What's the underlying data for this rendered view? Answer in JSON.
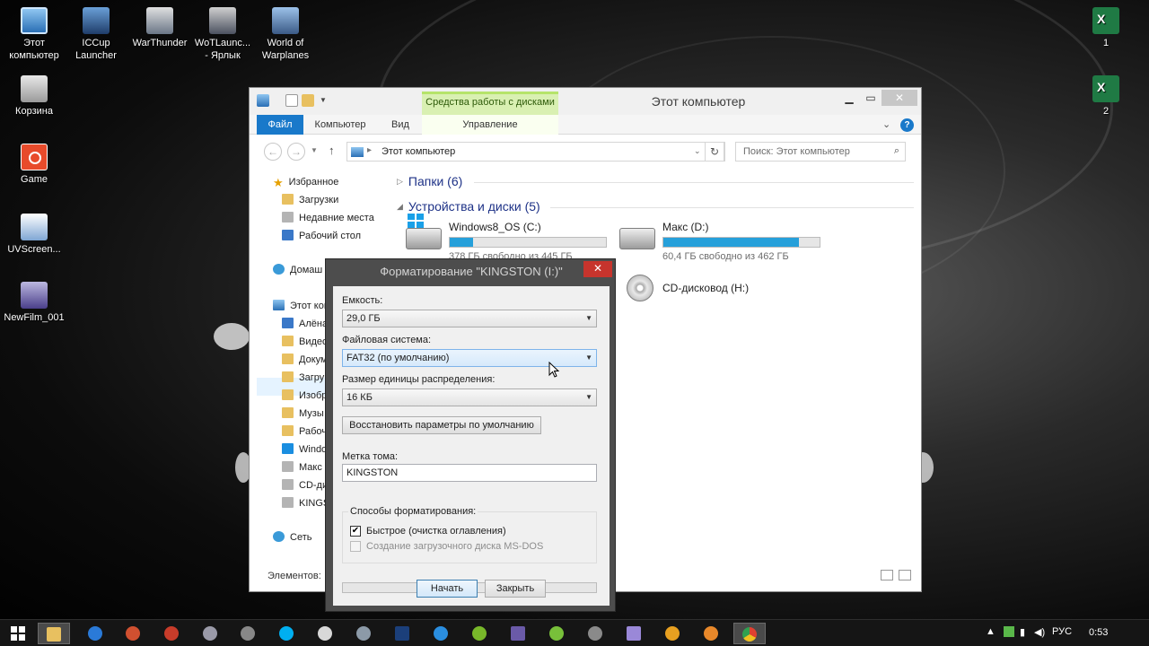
{
  "desktop": {
    "icons": [
      {
        "label1": "Этот",
        "label2": "компьютер",
        "icon": "computer-icon"
      },
      {
        "label1": "ICCup",
        "label2": "Launcher",
        "icon": "iccup-launcher-icon"
      },
      {
        "label1": "WarThunder",
        "label2": "",
        "icon": "warthunder-icon"
      },
      {
        "label1": "WoTLaunc...",
        "label2": "- Ярлык",
        "icon": "wot-launcher-icon"
      },
      {
        "label1": "World of",
        "label2": "Warplanes",
        "icon": "warplanes-icon"
      },
      {
        "label1": "Корзина",
        "label2": "",
        "icon": "recycle-bin-icon"
      },
      {
        "label1": "Game",
        "label2": "",
        "icon": "game-icon"
      },
      {
        "label1": "UVScreen...",
        "label2": "",
        "icon": "uvscreen-icon"
      },
      {
        "label1": "NewFilm_001",
        "label2": "",
        "icon": "avi-file-icon"
      },
      {
        "label1": "1",
        "label2": "",
        "icon": "excel-file-icon"
      },
      {
        "label1": "2",
        "label2": "",
        "icon": "excel-file-icon"
      }
    ]
  },
  "explorer": {
    "title": "Этот компьютер",
    "contextual_group": "Средства работы с дисками",
    "tabs": {
      "file": "Файл",
      "computer": "Компьютер",
      "view": "Вид",
      "manage": "Управление"
    },
    "address_path": "Этот компьютер",
    "search_placeholder": "Поиск: Этот компьютер",
    "nav": {
      "favorites": "Избранное",
      "downloads": "Загрузки",
      "recent": "Недавние места",
      "desktop": "Рабочий стол",
      "homegroup": "Домаш",
      "thispc": "Этот ком",
      "pc_items": [
        "Алёна",
        "Видео",
        "Докум",
        "Загру",
        "Изобр",
        "Музы",
        "Рабоч",
        "Windo",
        "Макс",
        "CD-ди",
        "KINGS"
      ],
      "network": "Сеть"
    },
    "groups": {
      "folders": "Папки (6)",
      "devices": "Устройства и диски (5)"
    },
    "drives": [
      {
        "name": "Windows8_OS (C:)",
        "free": "378 ГБ свободно из 445 ГБ",
        "used_fraction": 0.15
      },
      {
        "name": "Макс (D:)",
        "free": "60,4 ГБ свободно из 462 ГБ",
        "used_fraction": 0.87
      },
      {
        "name": "CD-дисковод (H:)"
      }
    ],
    "status": "Элементов: "
  },
  "format_dialog": {
    "title": "Форматирование \"KINGSTON (I:)\"",
    "capacity_label": "Емкость:",
    "capacity_value": "29,0 ГБ",
    "fs_label": "Файловая система:",
    "fs_value": "FAT32 (по умолчанию)",
    "alloc_label": "Размер единицы распределения:",
    "alloc_value": "16 КБ",
    "restore_button": "Восстановить параметры по умолчанию",
    "volume_label": "Метка тома:",
    "volume_value": "KINGSTON",
    "options_legend": "Способы форматирования:",
    "quick_format": "Быстрое (очистка оглавления)",
    "quick_format_checked": true,
    "msdos_disk": "Создание загрузочного диска MS-DOS",
    "start_button": "Начать",
    "close_button": "Закрыть"
  },
  "taskbar": {
    "language": "РУС",
    "clock": "0:53"
  }
}
